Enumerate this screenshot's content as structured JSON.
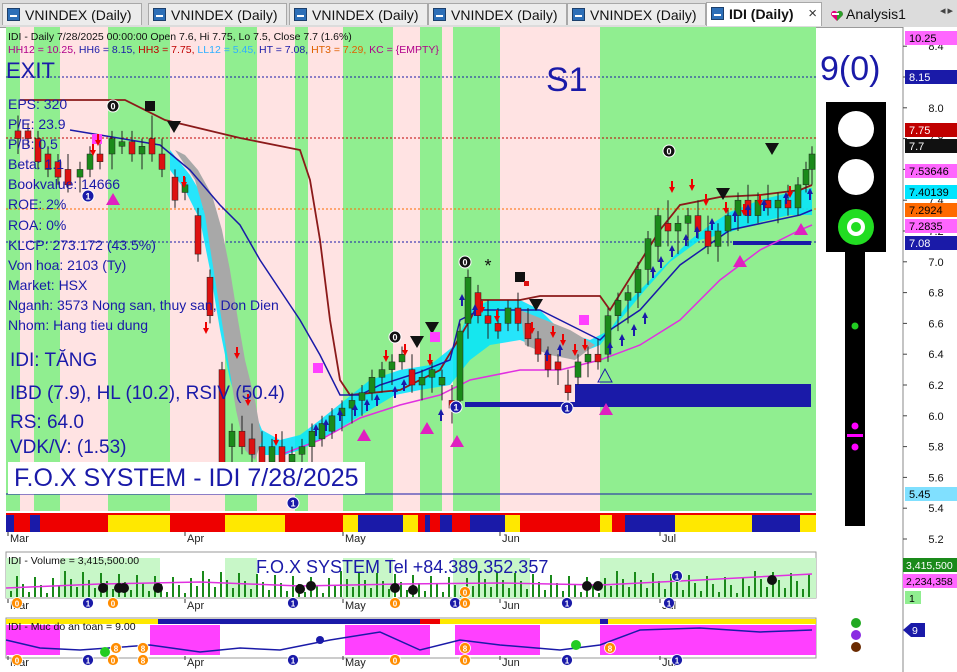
{
  "tabs": [
    {
      "label": "VNINDEX (Daily)",
      "active": false
    },
    {
      "label": "VNINDEX (Daily)",
      "active": false
    },
    {
      "label": "VNINDEX (Daily)",
      "active": false
    },
    {
      "label": "VNINDEX (Daily)",
      "active": false
    },
    {
      "label": "VNINDEX (Daily)",
      "active": false
    },
    {
      "label": "IDI (Daily)",
      "active": true,
      "close": "×"
    },
    {
      "label": "Analysis1",
      "active": false
    }
  ],
  "header": {
    "line1": "IDI - Daily 7/28/2025 00:00:00 Open 7.6, Hi 7.75, Lo 7.5, Close 7.7 (1.6%)",
    "line2_parts": [
      {
        "text": "HH12 = 10.25, ",
        "color": "#b0008a"
      },
      {
        "text": "HH6 = 8.15, ",
        "color": "#1a1aa8"
      },
      {
        "text": "HH3 = 7.75, ",
        "color": "#c00000"
      },
      {
        "text": "LL12 = 5.45, ",
        "color": "#30b0ff"
      },
      {
        "text": "HT = 7.08, ",
        "color": "#1a1aa8"
      },
      {
        "text": "HT3 = 7.29, ",
        "color": "#e06000"
      },
      {
        "text": "KC = {EMPTY}",
        "color": "#b0008a"
      }
    ]
  },
  "signals": {
    "exit": "EXIT",
    "s1": "S1",
    "counter": "9(0)"
  },
  "info": [
    "EPS: 320",
    "P/E: 23.9",
    "P/B: 0.5",
    "Beta: 1.1",
    "Bookvalue: 14666",
    "ROE: 2%",
    "ROA: 0%",
    "KLCP: 273.172 (43.5%)",
    "Von hoa: 2103 (Ty)",
    "Market: HSX",
    "Nganh: 3573 Nong san, thuy san, Don Dien",
    "Nhom: Hang tieu dung"
  ],
  "trend": {
    "idi": "IDI: TĂNG",
    "ibd": "IBD (7.9), HL (10.2), RSIV (50.4)",
    "rs": "RS: 64.0",
    "vdk": "VDK/V:  (1.53)"
  },
  "system_title": "F.O.X SYSTEM - IDI 7/28/2025",
  "price_axis": {
    "ticks": [
      "8.4",
      "8.2",
      "8.0",
      "7.8",
      "7.6",
      "7.4",
      "7.2",
      "7.0",
      "6.8",
      "6.6",
      "6.4",
      "6.2",
      "6.0",
      "5.8",
      "5.6",
      "5.4",
      "5.2"
    ]
  },
  "price_labels": [
    {
      "value": "10.25",
      "bg": "#ff66ff",
      "fg": "#000"
    },
    {
      "value": "8.15",
      "bg": "#1a1aa8",
      "fg": "#fff"
    },
    {
      "value": "7.75",
      "bg": "#c00000",
      "fg": "#fff"
    },
    {
      "value": "7.7",
      "bg": "#111111",
      "fg": "#fff"
    },
    {
      "value": "7.53646",
      "bg": "#ff66ff",
      "fg": "#000"
    },
    {
      "value": "7.40139",
      "bg": "#00e5ff",
      "fg": "#000"
    },
    {
      "value": "7.2924",
      "bg": "#ff6a00",
      "fg": "#000"
    },
    {
      "value": "7.2835",
      "bg": "#ff66ff",
      "fg": "#000"
    },
    {
      "value": "7.08",
      "bg": "#1a1aa8",
      "fg": "#fff"
    },
    {
      "value": "5.45",
      "bg": "#80e0ff",
      "fg": "#000"
    }
  ],
  "x_axis": {
    "months": [
      "Mar",
      "Apr",
      "May",
      "Jun",
      "Jul"
    ]
  },
  "volume_panel": {
    "title": "IDI - Volume = 3,415,500.00",
    "tel": "F.O.X SYSTEM Tel +84.389.352.357",
    "labels": [
      "3,415,500",
      "2,234,358",
      "1"
    ]
  },
  "safety_panel": {
    "title": "IDI - Muc do an toan = 9.00",
    "label": "9"
  },
  "colors": {
    "green": "#90ee90",
    "pink": "#ffe0e0",
    "blue": "#1a1aa8",
    "magenta": "#ff00ff",
    "dark_red": "#8b0000"
  }
}
